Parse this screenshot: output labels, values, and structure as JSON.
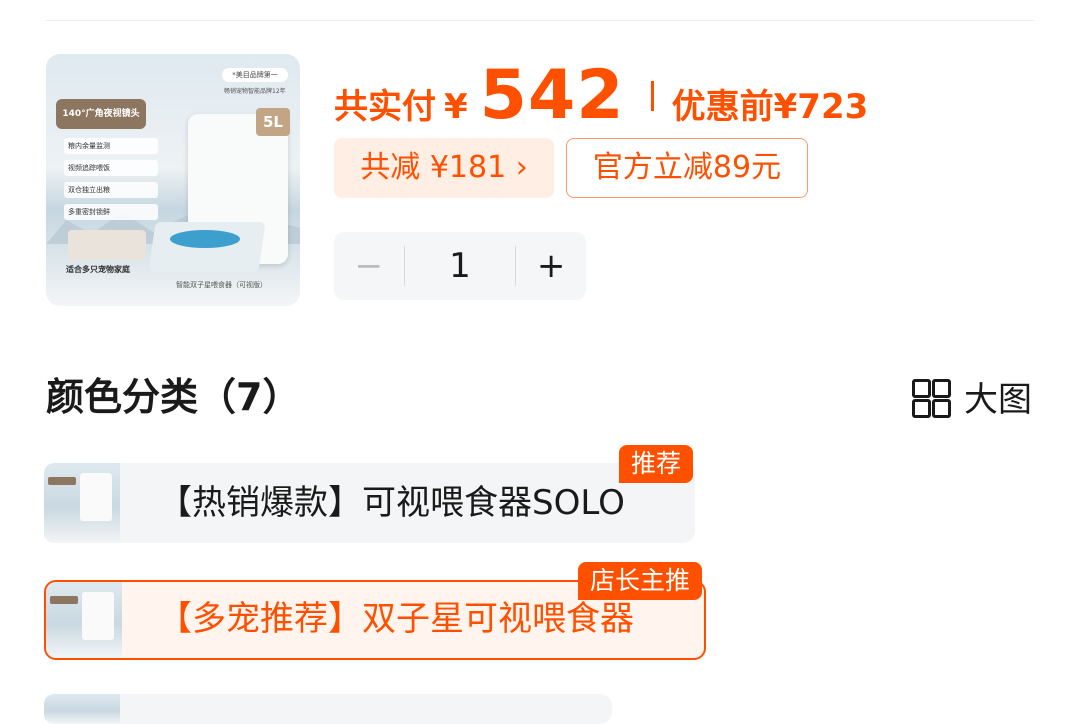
{
  "product": {
    "image_texts": {
      "camera_tag": "140°广角夜视镜头",
      "brand_rank": "*美目品牌第一",
      "brand_sub": "畅销宠物智能品牌12年",
      "capacity": "5L",
      "features": [
        "粮内余量监测",
        "视频追踪喂饭",
        "双仓独立出粮",
        "多重密封锁鲜"
      ],
      "pets_caption": "适合多只宠物家庭",
      "product_caption": "智能双子星喂食器（可视版）"
    }
  },
  "price": {
    "paid_label": "共实付",
    "currency": "¥",
    "amount": "542",
    "before_label": "优惠前",
    "before_amount": "¥723"
  },
  "discounts": {
    "total_reduced": "共减 ¥181 ›",
    "official_off": "官方立减89元"
  },
  "quantity": {
    "minus": "−",
    "value": "1",
    "plus": "+"
  },
  "section": {
    "title": "颜色分类（7）",
    "view_toggle_label": "大图"
  },
  "options": [
    {
      "label": "【热销爆款】可视喂食器SOLO",
      "tag": "推荐",
      "selected": false
    },
    {
      "label": "【多宠推荐】双子星可视喂食器",
      "tag": "店长主推",
      "selected": true
    }
  ],
  "colors": {
    "accent": "#ff5000",
    "accent_bg": "#ffeee4"
  }
}
